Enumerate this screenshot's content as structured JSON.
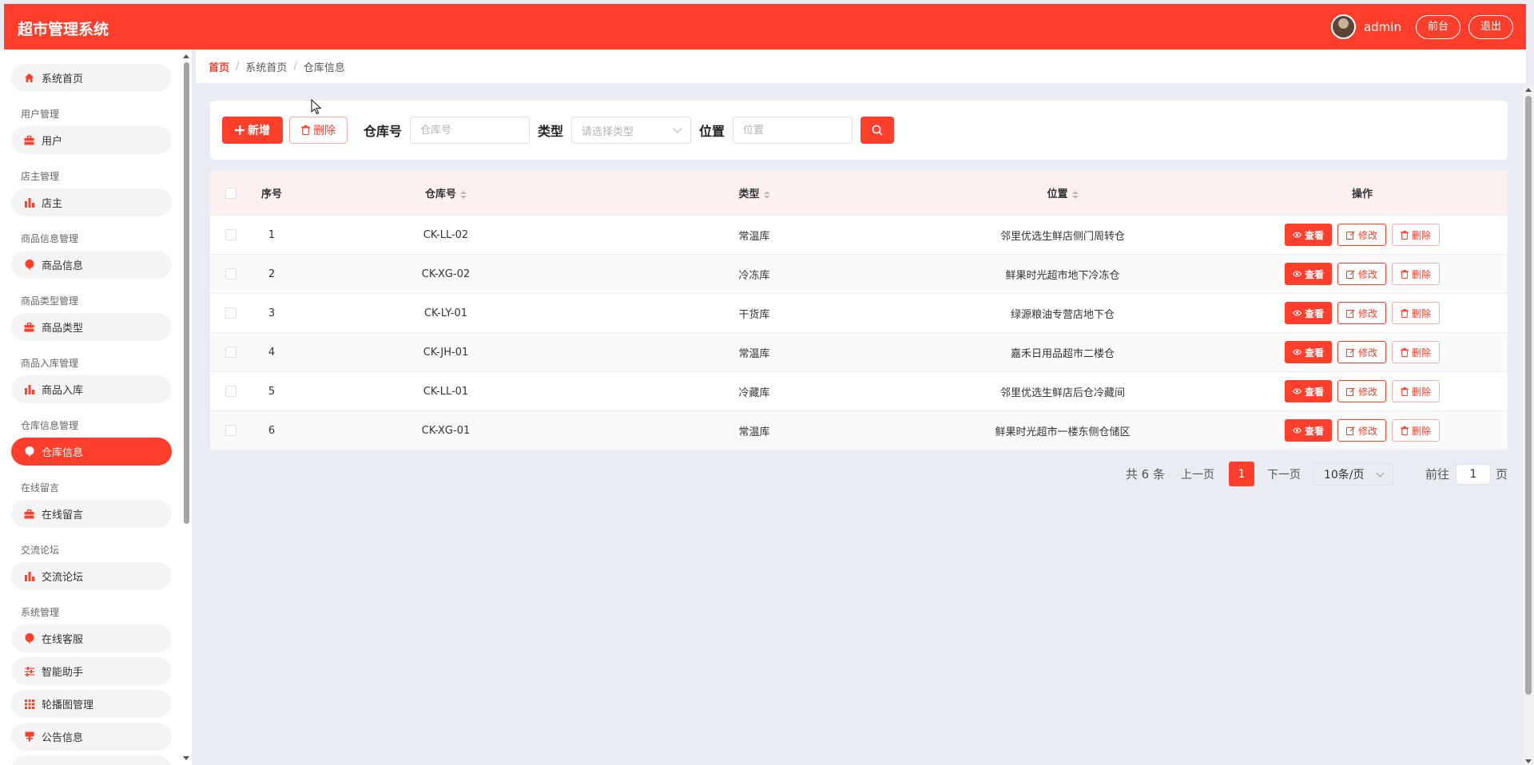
{
  "app": {
    "title": "超市管理系统"
  },
  "header": {
    "username": "admin",
    "front_btn": "前台",
    "logout_btn": "退出"
  },
  "sidebar": {
    "home": "系统首页",
    "groups": [
      {
        "title": "用户管理",
        "item": "用户",
        "icon": "briefcase-icon"
      },
      {
        "title": "店主管理",
        "item": "店主",
        "icon": "bar-chart-icon"
      },
      {
        "title": "商品信息管理",
        "item": "商品信息",
        "icon": "balloon-icon"
      },
      {
        "title": "商品类型管理",
        "item": "商品类型",
        "icon": "briefcase-icon"
      },
      {
        "title": "商品入库管理",
        "item": "商品入库",
        "icon": "bar-chart-icon"
      },
      {
        "title": "仓库信息管理",
        "item": "仓库信息",
        "icon": "balloon-icon"
      },
      {
        "title": "在线留言",
        "item": "在线留言",
        "icon": "briefcase-icon"
      },
      {
        "title": "交流论坛",
        "item": "交流论坛",
        "icon": "bar-chart-icon"
      },
      {
        "title": "系统管理",
        "items": [
          "在线客服",
          "智能助手",
          "轮播图管理",
          "公告信息"
        ]
      }
    ]
  },
  "breadcrumb": {
    "home": "首页",
    "level1": "系统首页",
    "level2": "仓库信息"
  },
  "toolbar": {
    "add_label": "新增",
    "delete_label": "删除",
    "code_label": "仓库号",
    "code_placeholder": "仓库号",
    "type_label": "类型",
    "type_placeholder": "请选择类型",
    "location_label": "位置",
    "location_placeholder": "位置"
  },
  "table": {
    "headers": {
      "no": "序号",
      "code": "仓库号",
      "type": "类型",
      "location": "位置",
      "actions": "操作"
    },
    "action_labels": {
      "view": "查看",
      "edit": "修改",
      "delete": "删除"
    },
    "rows": [
      {
        "no": "1",
        "code": "CK-LL-02",
        "type": "常温库",
        "location": "邻里优选生鲜店侧门周转仓"
      },
      {
        "no": "2",
        "code": "CK-XG-02",
        "type": "冷冻库",
        "location": "鲜果时光超市地下冷冻仓"
      },
      {
        "no": "3",
        "code": "CK-LY-01",
        "type": "干货库",
        "location": "绿源粮油专营店地下仓"
      },
      {
        "no": "4",
        "code": "CK-JH-01",
        "type": "常温库",
        "location": "嘉禾日用品超市二楼仓"
      },
      {
        "no": "5",
        "code": "CK-LL-01",
        "type": "冷藏库",
        "location": "邻里优选生鲜店后仓冷藏间"
      },
      {
        "no": "6",
        "code": "CK-XG-01",
        "type": "常温库",
        "location": "鲜果时光超市一楼东侧仓储区"
      }
    ]
  },
  "pagination": {
    "total_text": "共 6 条",
    "prev": "上一页",
    "current_page": "1",
    "next": "下一页",
    "page_size": "10条/页",
    "goto_label": "前往",
    "goto_value": "1",
    "page_suffix": "页"
  },
  "colors": {
    "accent": "#ff3f2c",
    "background": "#e9ecf3"
  }
}
